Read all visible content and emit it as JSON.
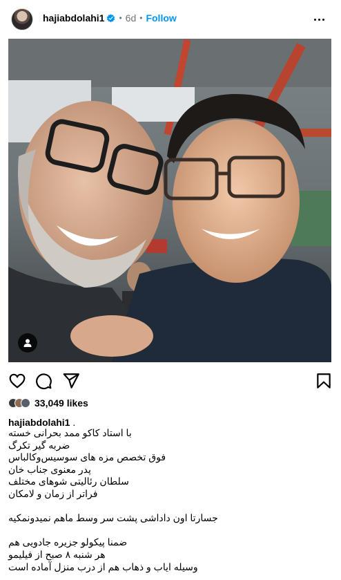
{
  "post": {
    "username": "hajiabdolahi1",
    "age": "6d",
    "separator": "•",
    "follow_label": "Follow",
    "likes": "33,049 likes",
    "caption_username": "hajiabdolahi1",
    "caption_suffix": ".",
    "caption_lines": [
      "با استاد کاکو ممد بحرانی خسته",
      "ضربه گیر تکرگ",
      "فوق تخصص مزه های سوسیس‌وکالباس",
      "پدر معنوی جناب خان",
      "سلطان رئالیتی شوهای مختلف",
      "فراتر از زمان و لامکان",
      "",
      "جسارتا اون داداشی پشت سر وسط ماهم نمیدونمکیه",
      "",
      "ضمنا پیکولو جزیره جادویی هم",
      "هر شنبه ۸ صبح از فیلیمو",
      "وسیله ایاب و ذهاب هم از درب منزل آماده است"
    ]
  },
  "icons": {
    "verified": "verified-badge-icon",
    "more": "more-options-icon",
    "like": "heart-icon",
    "comment": "comment-icon",
    "share": "send-icon",
    "save": "bookmark-icon",
    "tag": "user-tag-icon"
  },
  "colors": {
    "link": "#0095f6",
    "muted": "#737373",
    "verified": "#0095f6"
  }
}
